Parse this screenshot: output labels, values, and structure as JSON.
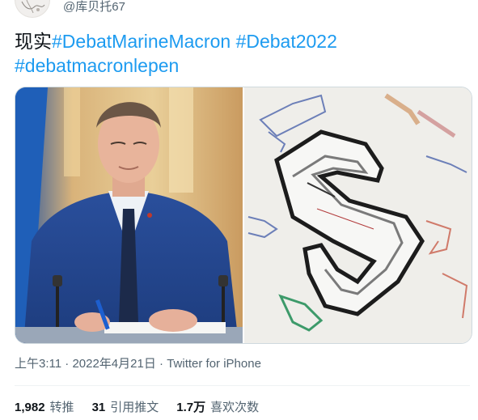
{
  "user": {
    "handle": "@库贝托67"
  },
  "tweet": {
    "text_prefix": "现实",
    "hashtags": [
      "#DebatMarineMacron",
      "#Debat2022",
      "#debatmacronlepen"
    ]
  },
  "meta": {
    "time": "上午3:11",
    "separator": "·",
    "date": "2022年4月21日",
    "source": "Twitter for iPhone"
  },
  "stats": {
    "retweets_count": "1,982",
    "retweets_label": "转推",
    "quotes_count": "31",
    "quotes_label": "引用推文",
    "likes_count": "1.7万",
    "likes_label": "喜欢次数"
  },
  "colors": {
    "accent": "#1d9bf0",
    "text": "#0f1419",
    "secondary": "#536471"
  }
}
